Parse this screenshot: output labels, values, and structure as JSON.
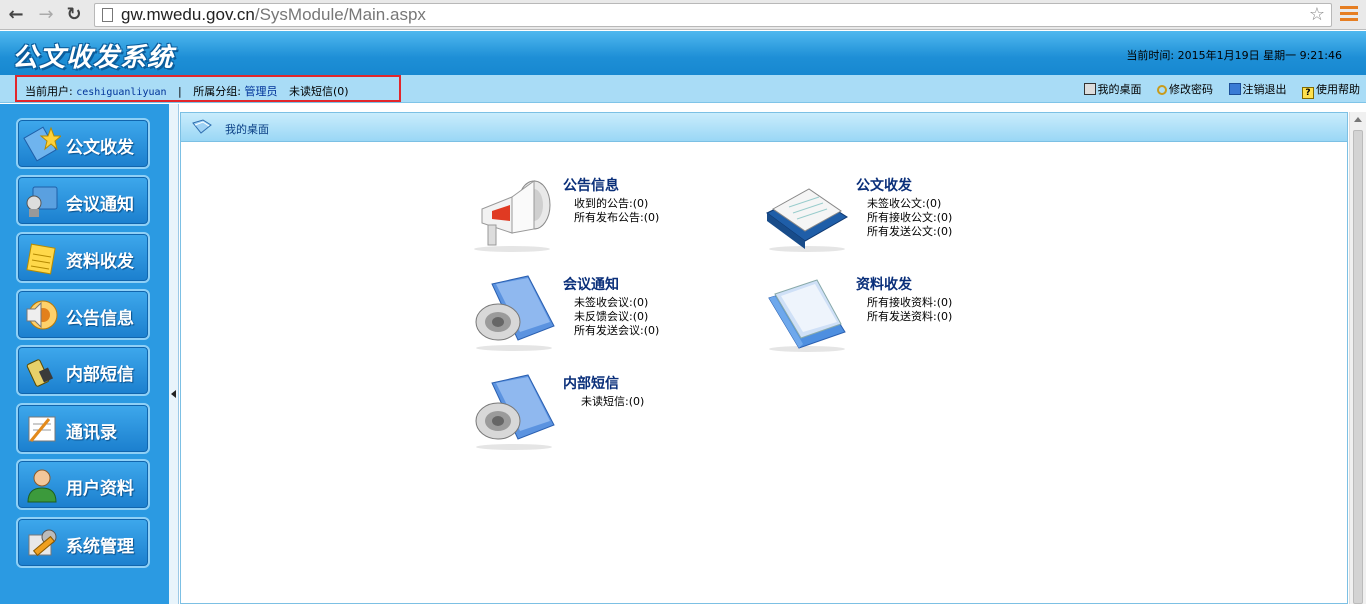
{
  "browser": {
    "url_host": "gw.mwedu.gov.cn",
    "url_path": "/SysModule/Main.aspx"
  },
  "header": {
    "app_title": "公文收发系统",
    "clock": "当前时间: 2015年1月19日 星期一 9:21:46"
  },
  "user_bar": {
    "user_label": "当前用户:",
    "username": "ceshiguanliyuan",
    "separator": "|",
    "group_label": "所属分组:",
    "group": "管理员",
    "unread": "未读短信(0)"
  },
  "top_links": {
    "desktop": "我的桌面",
    "change_password": "修改密码",
    "logout": "注销退出",
    "help": "使用帮助"
  },
  "sidebar": {
    "items": [
      {
        "label": "公文收发",
        "icon": "document-star-icon"
      },
      {
        "label": "会议通知",
        "icon": "meeting-icon"
      },
      {
        "label": "资料收发",
        "icon": "notepad-icon"
      },
      {
        "label": "公告信息",
        "icon": "speaker-icon"
      },
      {
        "label": "内部短信",
        "icon": "phone-icon"
      },
      {
        "label": "通讯录",
        "icon": "address-book-icon"
      },
      {
        "label": "用户资料",
        "icon": "user-icon"
      },
      {
        "label": "系统管理",
        "icon": "tools-icon"
      }
    ]
  },
  "main": {
    "title": "我的桌面",
    "cards": {
      "notice": {
        "title": "公告信息",
        "lines": [
          "收到的公告:(0)",
          "所有发布公告:(0)"
        ]
      },
      "document": {
        "title": "公文收发",
        "lines": [
          "未签收公文:(0)",
          "所有接收公文:(0)",
          "所有发送公文:(0)"
        ]
      },
      "meeting": {
        "title": "会议通知",
        "lines": [
          "未签收会议:(0)",
          "未反馈会议:(0)",
          "所有发送会议:(0)"
        ]
      },
      "material": {
        "title": "资料收发",
        "lines": [
          "所有接收资料:(0)",
          "所有发送资料:(0)"
        ]
      },
      "sms": {
        "title": "内部短信",
        "lines": [
          "未读短信:(0)"
        ]
      }
    }
  }
}
